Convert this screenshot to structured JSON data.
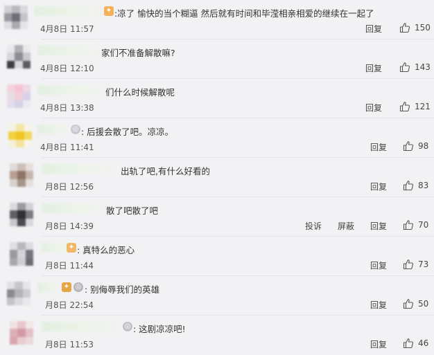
{
  "comments": [
    {
      "text": ":凉了 愉快的当个糊逼 然后就有时间和毕滢相亲相爱的继续在一起了",
      "time": "4月8日 11:57",
      "reply": "回复",
      "likes": "150"
    },
    {
      "text": "家们不准备解散嘛?",
      "time": "4月8日 12:10",
      "reply": "回复",
      "likes": "143"
    },
    {
      "text": "们什么时候解散呢",
      "time": "4月8日 13:38",
      "reply": "回复",
      "likes": "121"
    },
    {
      "text": ": 后援会散了吧。凉凉。",
      "time": "4月8日 11:41",
      "reply": "回复",
      "likes": "98"
    },
    {
      "text": "出轨了吧,有什么好看的",
      "time": "月8日 12:56",
      "reply": "回复",
      "likes": "83"
    },
    {
      "text": "散了吧散了吧",
      "time": "月8日 14:39",
      "report": "投诉",
      "block": "屏蔽",
      "reply": "回复",
      "likes": "70"
    },
    {
      "text": ": 真特么的恶心",
      "time": "月8日 11:44",
      "reply": "回复",
      "likes": "73"
    },
    {
      "text": ": 别侮辱我们的英雄",
      "time": "月8日 22:54",
      "reply": "回复",
      "likes": "50"
    },
    {
      "text": ": 这剧凉凉吧!",
      "time": "月8日 11:53",
      "reply": "回复",
      "likes": "46"
    }
  ]
}
